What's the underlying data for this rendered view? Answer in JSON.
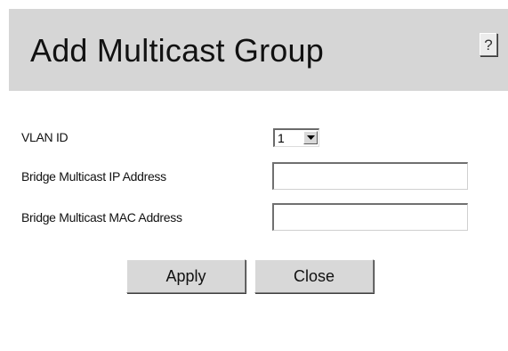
{
  "dialog": {
    "title": "Add Multicast Group",
    "help_label": "?"
  },
  "form": {
    "vlan_id": {
      "label": "VLAN ID",
      "selected_value": "1"
    },
    "bridge_ip": {
      "label": "Bridge Multicast IP Address",
      "value": ""
    },
    "bridge_mac": {
      "label": "Bridge Multicast MAC Address",
      "value": ""
    }
  },
  "buttons": {
    "apply_label": "Apply",
    "close_label": "Close"
  },
  "icons": {
    "select_arrow": "chevron-down-icon"
  },
  "colors": {
    "title_band": "#d6d6d6",
    "panel": "#ffffff",
    "button_face": "#d8d8d8"
  }
}
